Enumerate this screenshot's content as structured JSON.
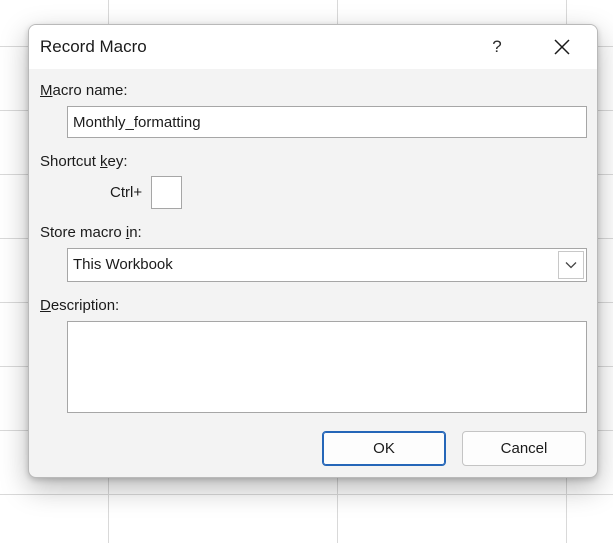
{
  "dialog": {
    "title": "Record Macro",
    "help_glyph": "?",
    "close_icon": "close-icon"
  },
  "macro_name": {
    "label_prefix": "",
    "label_mnemonic": "M",
    "label_rest": "acro name:",
    "value": "Monthly_formatting"
  },
  "shortcut_key": {
    "label_prefix": "Shortcut ",
    "label_mnemonic": "k",
    "label_rest": "ey:",
    "ctrl_label": "Ctrl+",
    "value": ""
  },
  "store_macro": {
    "label_prefix": "Store macro ",
    "label_mnemonic": "i",
    "label_rest": "n:",
    "selected": "This Workbook",
    "arrow_icon": "chevron-down-icon"
  },
  "description": {
    "label_prefix": "",
    "label_mnemonic": "D",
    "label_rest": "escription:",
    "value": ""
  },
  "buttons": {
    "ok": "OK",
    "cancel": "Cancel"
  },
  "colors": {
    "dialog_bg": "#f3f3f3",
    "titlebar_bg": "#ffffff",
    "ok_border": "#2566b8"
  }
}
